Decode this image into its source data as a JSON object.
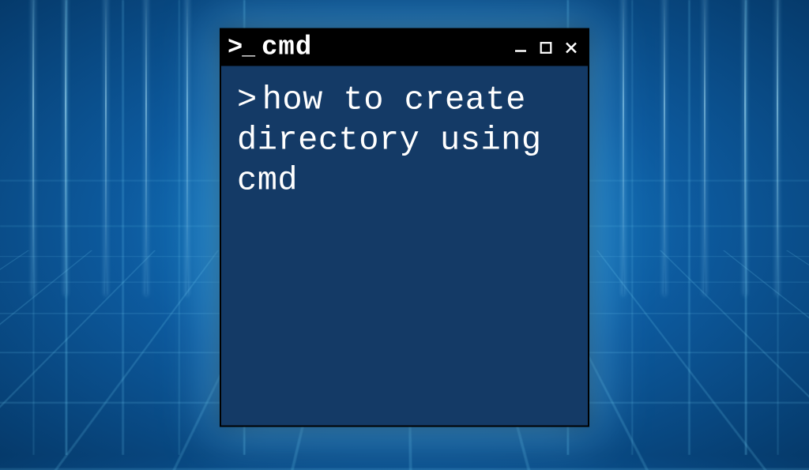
{
  "window": {
    "title": "cmd",
    "icons": {
      "prompt": "prompt-icon",
      "minimize": "minimize-icon",
      "maximize": "maximize-icon",
      "close": "close-icon"
    }
  },
  "terminal": {
    "prompt": ">",
    "content": "how to create directory using cmd"
  },
  "colors": {
    "terminal_bg": "#143a66",
    "titlebar_bg": "#000000",
    "text": "#ffffff",
    "accent_glow": "#78dcff"
  }
}
